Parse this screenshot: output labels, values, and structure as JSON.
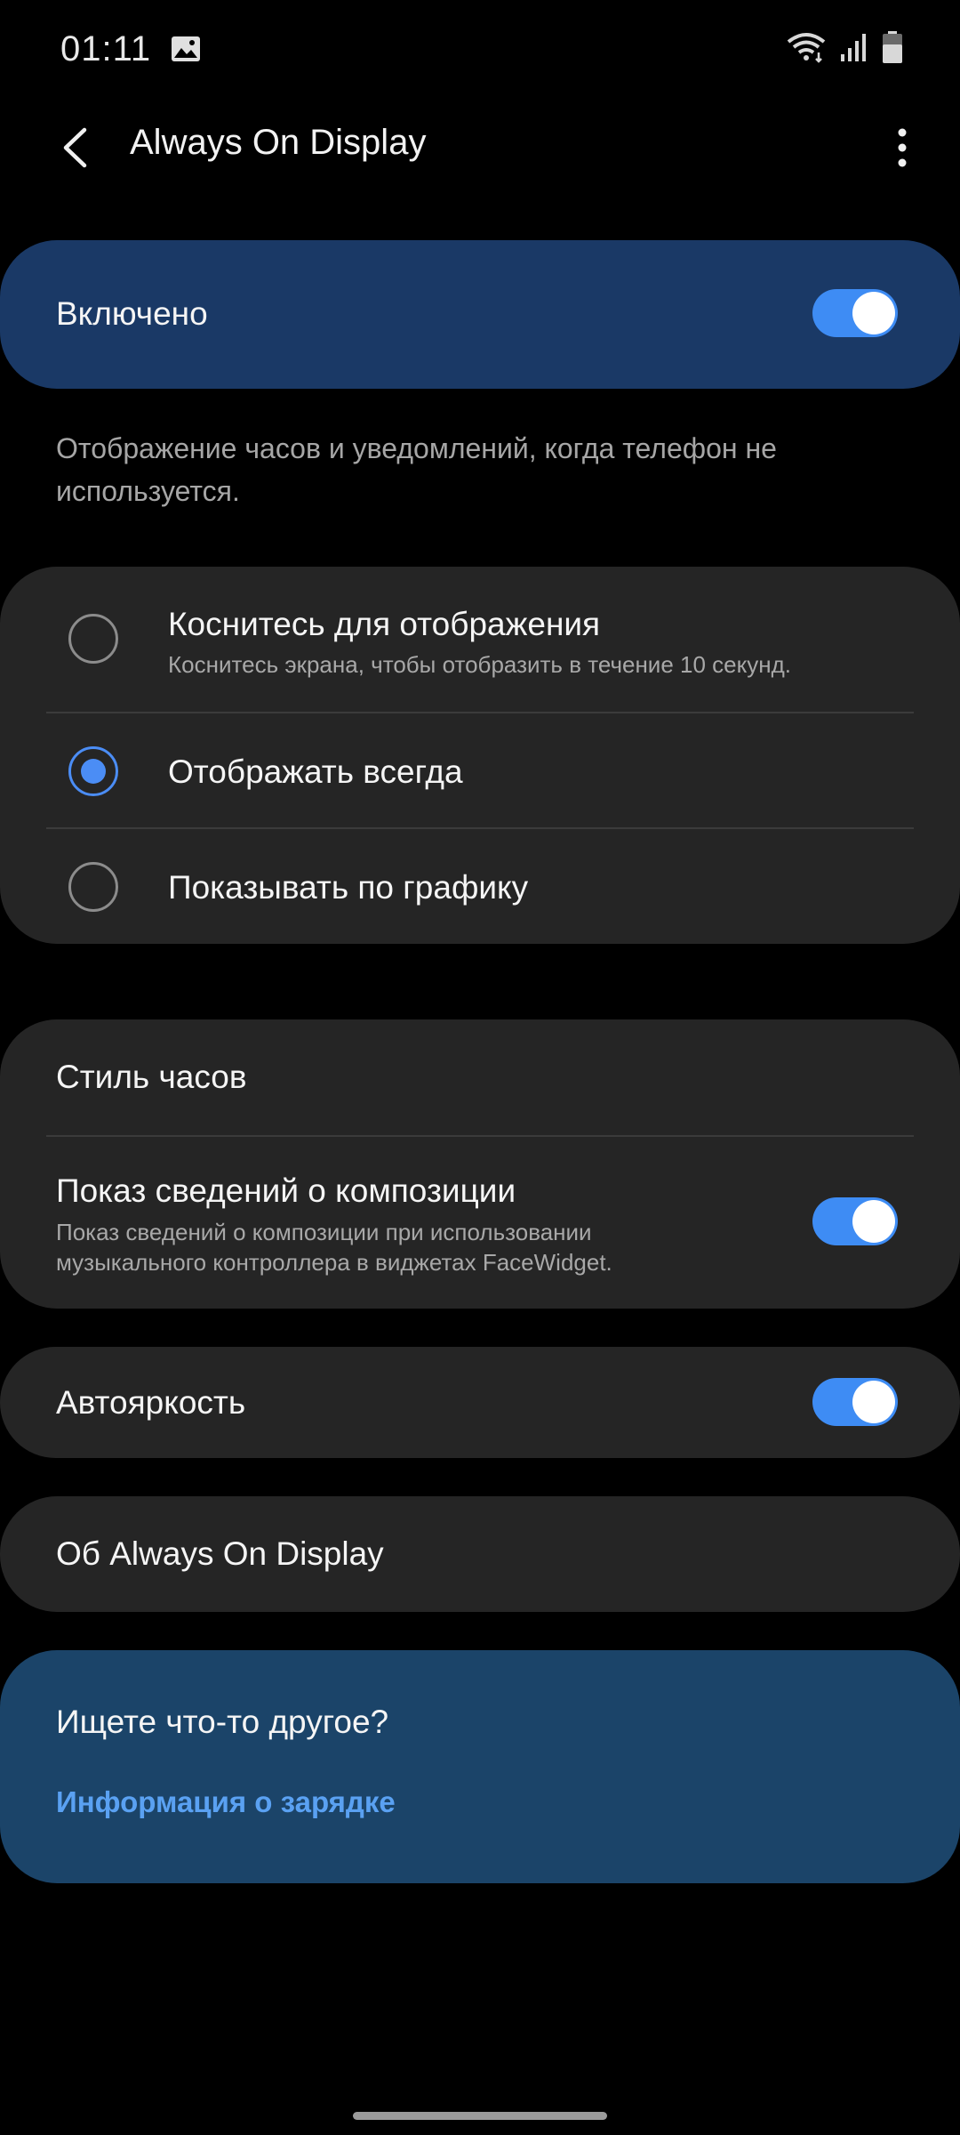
{
  "status_bar": {
    "time": "01:11",
    "icons": [
      "image-icon",
      "wifi-icon",
      "signal-icon",
      "battery-icon"
    ]
  },
  "app_bar": {
    "title": "Always On Display",
    "back_icon": "back-arrow-icon",
    "more_icon": "more-vertical-icon"
  },
  "master_switch": {
    "label": "Включено",
    "on": true
  },
  "description": "Отображение часов и уведомлений, когда телефон не используется.",
  "display_mode": {
    "options": [
      {
        "label": "Коснитесь для отображения",
        "sub": "Коснитесь экрана, чтобы отобразить в течение 10 секунд.",
        "selected": false
      },
      {
        "label": "Отображать всегда",
        "sub": "",
        "selected": true
      },
      {
        "label": "Показывать по графику",
        "sub": "",
        "selected": false
      }
    ]
  },
  "settings": {
    "clock_style": "Стиль часов",
    "music_info": {
      "label": "Показ сведений о композиции",
      "sub": "Показ сведений о композиции при использовании музыкального контроллера в виджетах FaceWidget.",
      "on": true
    },
    "auto_brightness": {
      "label": "Автояркость",
      "on": true
    },
    "about": "Об Always On Display"
  },
  "suggestions": {
    "title": "Ищете что-то другое?",
    "link": "Информация о зарядке"
  },
  "colors": {
    "accent": "#3e8cf4",
    "card": "#252525",
    "master_card": "#1a3966",
    "info_card": "#1b4469",
    "link": "#5aa1f2"
  }
}
